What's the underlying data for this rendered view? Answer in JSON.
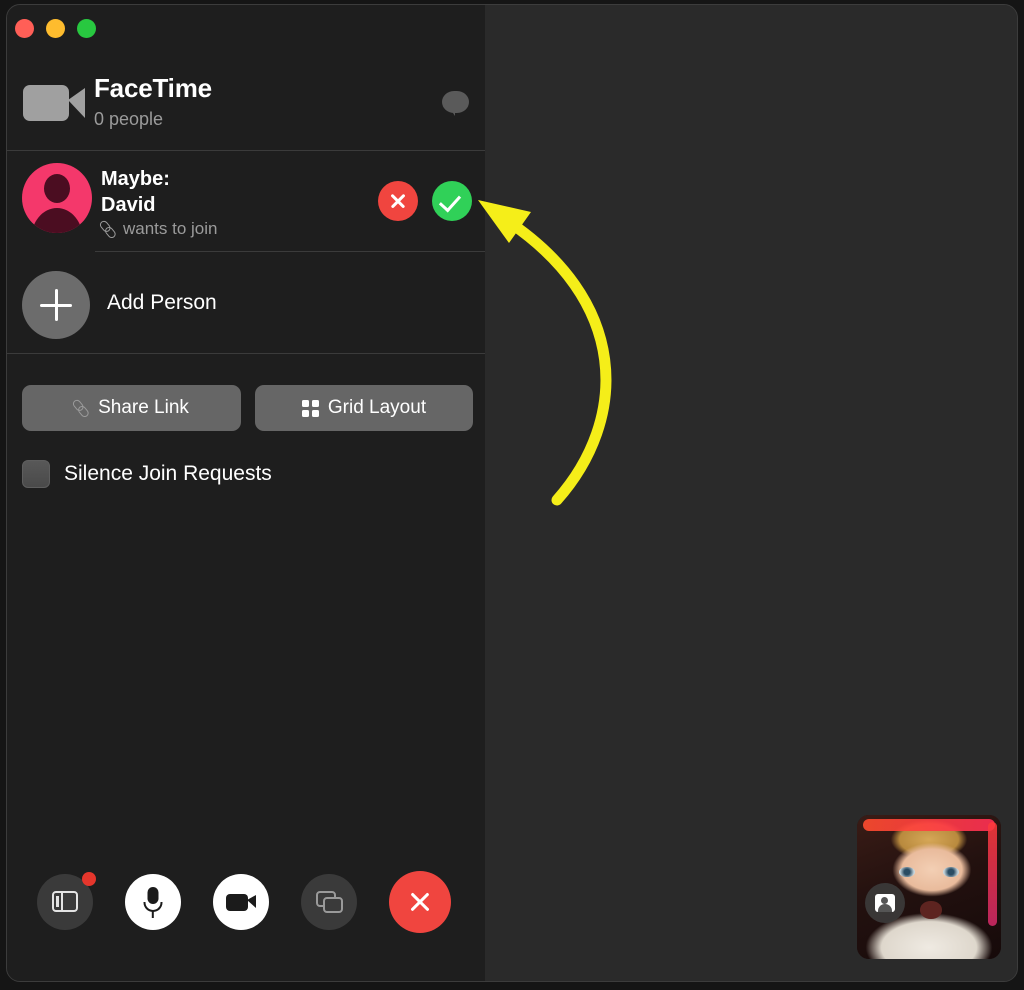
{
  "window": {
    "traffic_lights": [
      {
        "name": "close",
        "color": "#ff5f57"
      },
      {
        "name": "minimize",
        "color": "#febc2e"
      },
      {
        "name": "maximize",
        "color": "#28c840"
      }
    ]
  },
  "sidebar": {
    "header": {
      "icon": "video-camera-icon",
      "title": "FaceTime",
      "subtitle": "0 people",
      "chat_icon": "chat-bubble-icon"
    },
    "join_request": {
      "avatar_icon": "person-avatar-icon",
      "name_line_1": "Maybe:",
      "name_line_2": "David",
      "status_icon": "link-icon",
      "status": "wants to join",
      "decline_icon": "x-icon",
      "accept_icon": "checkmark-icon",
      "decline_color": "#f0453f",
      "accept_color": "#30d158"
    },
    "add_person": {
      "icon": "plus-icon",
      "label": "Add Person"
    },
    "actions": [
      {
        "name": "share-link",
        "icon": "link-icon",
        "label": "Share Link"
      },
      {
        "name": "grid-layout",
        "icon": "grid-icon",
        "label": "Grid Layout"
      }
    ],
    "silence": {
      "label": "Silence Join Requests",
      "checked": false
    }
  },
  "toolbar": [
    {
      "name": "sidebar-toggle",
      "icon": "sidebar-icon",
      "style": "dark",
      "badge": true
    },
    {
      "name": "microphone",
      "icon": "microphone-icon",
      "style": "light",
      "badge": false
    },
    {
      "name": "video",
      "icon": "video-camera-icon",
      "style": "light",
      "badge": false
    },
    {
      "name": "share-screen",
      "icon": "screen-share-icon",
      "style": "dark",
      "badge": false
    },
    {
      "name": "end-call",
      "icon": "x-icon",
      "style": "red",
      "badge": false
    }
  ],
  "self_view": {
    "effects_icon": "portrait-card-icon"
  },
  "annotation": {
    "color": "#f5ee19",
    "shape": "curved-arrow",
    "points_to": "accept-join-request-button"
  }
}
